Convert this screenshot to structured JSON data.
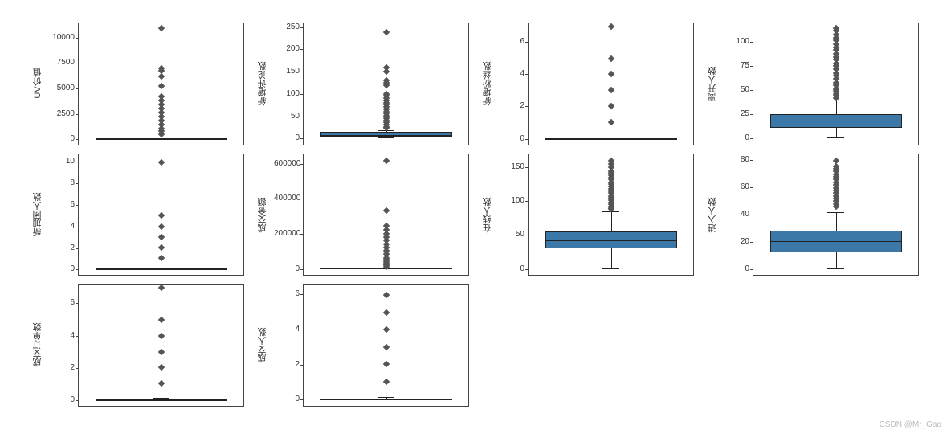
{
  "watermark": "CSDN @Mr_Gao",
  "chart_data": [
    {
      "type": "boxplot",
      "ylabel": "UV价值",
      "ylim": [
        -600,
        11500
      ],
      "yticks": [
        0,
        2500,
        5000,
        7500,
        10000
      ],
      "q1": 0,
      "median": 0,
      "q3": 20,
      "whisker_low": 0,
      "whisker_high": 50,
      "outliers": [
        11000,
        7000,
        6800,
        6200,
        5200,
        4200,
        3800,
        3400,
        3000,
        2600,
        2200,
        1800,
        1400,
        1000,
        700,
        400
      ]
    },
    {
      "type": "boxplot",
      "ylabel": "新增评论数",
      "ylim": [
        -15,
        260
      ],
      "yticks": [
        0,
        50,
        100,
        150,
        200,
        250
      ],
      "q1": 2,
      "median": 6,
      "q3": 14,
      "whisker_low": 0,
      "whisker_high": 18,
      "outliers": [
        240,
        160,
        150,
        130,
        125,
        120,
        100,
        95,
        90,
        85,
        80,
        75,
        70,
        65,
        60,
        55,
        50,
        45,
        40,
        35,
        30,
        25,
        22
      ]
    },
    {
      "type": "boxplot",
      "ylabel": "新增粉丝数",
      "ylim": [
        -0.4,
        7.2
      ],
      "yticks": [
        0,
        2,
        4,
        6
      ],
      "q1": 0,
      "median": 0,
      "q3": 0,
      "whisker_low": 0,
      "whisker_high": 0,
      "outliers": [
        7,
        5,
        4,
        3,
        2,
        1
      ]
    },
    {
      "type": "boxplot",
      "ylabel": "离开人数",
      "ylim": [
        -7,
        120
      ],
      "yticks": [
        0,
        25,
        50,
        75,
        100
      ],
      "q1": 10,
      "median": 18,
      "q3": 25,
      "whisker_low": 0,
      "whisker_high": 40,
      "outliers": [
        115,
        112,
        108,
        105,
        102,
        98,
        95,
        92,
        88,
        85,
        82,
        78,
        75,
        72,
        68,
        65,
        62,
        58,
        55,
        52,
        50,
        48,
        46,
        44,
        42
      ]
    },
    {
      "type": "boxplot",
      "ylabel": "新加团人数",
      "ylim": [
        -0.6,
        10.8
      ],
      "yticks": [
        0,
        2,
        4,
        6,
        8,
        10
      ],
      "q1": 0,
      "median": 0,
      "q3": 0,
      "whisker_low": 0,
      "whisker_high": 0.1,
      "outliers": [
        10,
        5,
        4,
        3,
        2,
        1
      ]
    },
    {
      "type": "boxplot",
      "ylabel": "成交金额",
      "ylim": [
        -40000,
        660000
      ],
      "yticks": [
        0,
        200000,
        400000,
        600000
      ],
      "q1": 0,
      "median": 0,
      "q3": 2000,
      "whisker_low": 0,
      "whisker_high": 5000,
      "outliers": [
        620000,
        335000,
        245000,
        220000,
        200000,
        180000,
        160000,
        140000,
        120000,
        100000,
        80000,
        60000,
        50000,
        40000,
        30000,
        20000,
        15000,
        10000
      ]
    },
    {
      "type": "boxplot",
      "ylabel": "在线人数",
      "ylim": [
        -10,
        170
      ],
      "yticks": [
        0,
        50,
        100,
        150
      ],
      "q1": 30,
      "median": 42,
      "q3": 55,
      "whisker_low": 0,
      "whisker_high": 85,
      "outliers": [
        160,
        155,
        150,
        145,
        142,
        138,
        135,
        132,
        128,
        125,
        122,
        118,
        115,
        112,
        108,
        105,
        102,
        98,
        95,
        92,
        90,
        88
      ]
    },
    {
      "type": "boxplot",
      "ylabel": "进入人数",
      "ylim": [
        -5,
        85
      ],
      "yticks": [
        0,
        20,
        40,
        60,
        80
      ],
      "q1": 12,
      "median": 20,
      "q3": 28,
      "whisker_low": 0,
      "whisker_high": 42,
      "outliers": [
        80,
        76,
        74,
        72,
        70,
        68,
        66,
        64,
        62,
        60,
        58,
        56,
        54,
        52,
        50,
        48,
        46
      ]
    },
    {
      "type": "boxplot",
      "ylabel": "成交订单数",
      "ylim": [
        -0.4,
        7.2
      ],
      "yticks": [
        0,
        2,
        4,
        6
      ],
      "q1": 0,
      "median": 0,
      "q3": 0,
      "whisker_low": 0,
      "whisker_high": 0.1,
      "outliers": [
        7,
        5,
        4,
        3,
        2,
        1
      ]
    },
    {
      "type": "boxplot",
      "ylabel": "成交人数",
      "ylim": [
        -0.4,
        6.6
      ],
      "yticks": [
        0,
        2,
        4,
        6
      ],
      "q1": 0,
      "median": 0,
      "q3": 0,
      "whisker_low": 0,
      "whisker_high": 0.1,
      "outliers": [
        6,
        5,
        4,
        3,
        2,
        1
      ]
    }
  ]
}
